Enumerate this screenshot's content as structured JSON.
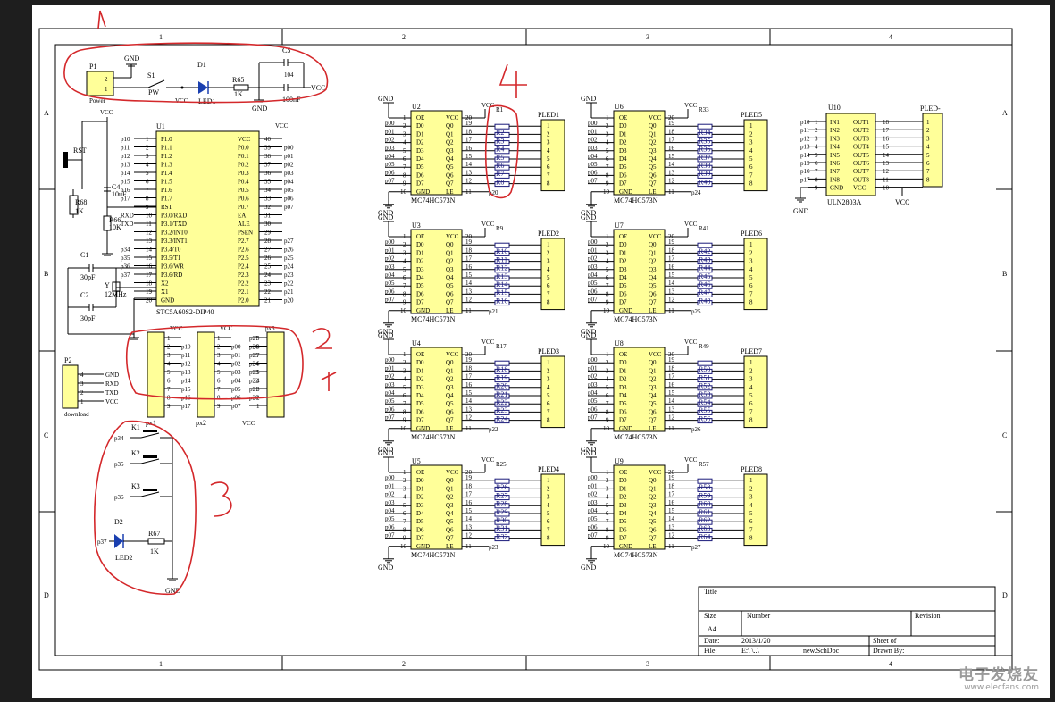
{
  "zones": {
    "cols": [
      "1",
      "2",
      "3",
      "4"
    ],
    "rows": [
      "A",
      "B",
      "C",
      "D"
    ]
  },
  "annotations": [
    "1",
    "2",
    "3",
    "4"
  ],
  "power": {
    "connector_ref": "P1",
    "connector_name": "Power",
    "pins": [
      "2",
      "1"
    ],
    "switch_ref": "S1",
    "switch_name": "PW",
    "led_ref": "D1",
    "led_name": "LED1",
    "res_ref": "R65",
    "res_val": "1K",
    "cap_ref": "C5",
    "cap_val": "100nF",
    "ecap": "104",
    "gnd": "GND",
    "vcc": "VCC"
  },
  "mcu": {
    "ref": "U1",
    "name": "STC5A60S2-DIP40",
    "left_pins": [
      {
        "num": "1",
        "name": "P1.0",
        "net": "p10"
      },
      {
        "num": "2",
        "name": "P1.1",
        "net": "p11"
      },
      {
        "num": "3",
        "name": "P1.2",
        "net": "p12"
      },
      {
        "num": "4",
        "name": "P1.3",
        "net": "p13"
      },
      {
        "num": "5",
        "name": "P1.4",
        "net": "p14"
      },
      {
        "num": "6",
        "name": "P1.5",
        "net": "p15"
      },
      {
        "num": "7",
        "name": "P1.6",
        "net": "p16"
      },
      {
        "num": "8",
        "name": "P1.7",
        "net": "p17"
      },
      {
        "num": "9",
        "name": "RST",
        "net": ""
      },
      {
        "num": "10",
        "name": "P3.0/RXD",
        "net": "RXD"
      },
      {
        "num": "11",
        "name": "P3.1/TXD",
        "net": "TXD"
      },
      {
        "num": "12",
        "name": "P3.2/INT0",
        "net": ""
      },
      {
        "num": "13",
        "name": "P3.3/INT1",
        "net": ""
      },
      {
        "num": "14",
        "name": "P3.4/T0",
        "net": "p34"
      },
      {
        "num": "15",
        "name": "P3.5/T1",
        "net": "p35"
      },
      {
        "num": "16",
        "name": "P3.6/WR",
        "net": "p36"
      },
      {
        "num": "17",
        "name": "P3.6/RD",
        "net": "p37"
      },
      {
        "num": "18",
        "name": "X2",
        "net": ""
      },
      {
        "num": "19",
        "name": "X1",
        "net": ""
      },
      {
        "num": "20",
        "name": "GND",
        "net": ""
      }
    ],
    "right_pins": [
      {
        "num": "40",
        "name": "VCC",
        "net": ""
      },
      {
        "num": "39",
        "name": "P0.0",
        "net": "p00"
      },
      {
        "num": "38",
        "name": "P0.1",
        "net": "p01"
      },
      {
        "num": "37",
        "name": "P0.2",
        "net": "p02"
      },
      {
        "num": "36",
        "name": "P0.3",
        "net": "p03"
      },
      {
        "num": "35",
        "name": "P0.4",
        "net": "p04"
      },
      {
        "num": "34",
        "name": "P0.5",
        "net": "p05"
      },
      {
        "num": "33",
        "name": "P0.6",
        "net": "p06"
      },
      {
        "num": "32",
        "name": "P0.7",
        "net": "p07"
      },
      {
        "num": "31",
        "name": "EA",
        "net": ""
      },
      {
        "num": "30",
        "name": "ALE",
        "net": ""
      },
      {
        "num": "29",
        "name": "PSEN",
        "net": ""
      },
      {
        "num": "28",
        "name": "P2.7",
        "net": "p27"
      },
      {
        "num": "27",
        "name": "P2.6",
        "net": "p26"
      },
      {
        "num": "26",
        "name": "P2.5",
        "net": "p25"
      },
      {
        "num": "25",
        "name": "P2.4",
        "net": "p24"
      },
      {
        "num": "24",
        "name": "P2.3",
        "net": "p23"
      },
      {
        "num": "23",
        "name": "P2.2",
        "net": "p22"
      },
      {
        "num": "22",
        "name": "P2.1",
        "net": "p21"
      },
      {
        "num": "21",
        "name": "P2.0",
        "net": "p20"
      }
    ],
    "vcc": "VCC"
  },
  "reset": {
    "button": "RST",
    "res_ref": "R68",
    "res_val": "1K",
    "cap_ref": "C4",
    "cap_val": "10uF",
    "pd_ref": "R66",
    "pd_val": "10K",
    "vcc": "VCC"
  },
  "crystal": {
    "c1_ref": "C1",
    "c1_val": "30pF",
    "c2_ref": "C2",
    "c2_val": "30pF",
    "y_ref": "Y",
    "y_val": "12MHz"
  },
  "download": {
    "ref": "P2",
    "name": "download",
    "pins": [
      "4",
      "3",
      "2",
      "1"
    ],
    "nets": [
      "GND",
      "RXD",
      "TXD",
      "VCC"
    ]
  },
  "headers": [
    {
      "ref": "px1",
      "vcc": "VCC",
      "nums": [
        "1",
        "2",
        "3",
        "4",
        "5",
        "6",
        "7",
        "8",
        "9"
      ],
      "nets": [
        "",
        "p10",
        "p11",
        "p12",
        "p13",
        "p14",
        "p15",
        "p16",
        "p17"
      ]
    },
    {
      "ref": "px2",
      "vcc": "VCC",
      "nums": [
        "1",
        "2",
        "3",
        "4",
        "5",
        "6",
        "7",
        "8",
        "9"
      ],
      "nets": [
        "",
        "p00",
        "p01",
        "p02",
        "p03",
        "p04",
        "p05",
        "p06",
        "p07"
      ]
    },
    {
      "ref": "px3",
      "vcc": "VCC",
      "nums": [
        "9",
        "8",
        "7",
        "6",
        "5",
        "4",
        "3",
        "2",
        "1"
      ],
      "nets": [
        "p27",
        "p26",
        "p25",
        "p24",
        "p23",
        "p22",
        "p21",
        "p20",
        ""
      ]
    }
  ],
  "keys": {
    "k1": "K1",
    "k2": "K2",
    "k3": "K3",
    "p34": "p34",
    "p35": "p35",
    "p36": "p36",
    "p37": "p37",
    "led_ref": "D2",
    "led_name": "LED2",
    "res_ref": "R67",
    "res_val": "1K",
    "gnd": "GND"
  },
  "latch": {
    "in_pins": [
      "2",
      "3",
      "4",
      "5",
      "6",
      "7",
      "8",
      "9"
    ],
    "out_pins": [
      "19",
      "18",
      "17",
      "16",
      "15",
      "14",
      "13",
      "12"
    ],
    "left_names": [
      "OE",
      "D0",
      "D1",
      "D2",
      "D3",
      "D4",
      "D5",
      "D6",
      "D7",
      "GND"
    ],
    "right_names": [
      "VCC",
      "Q0",
      "Q1",
      "Q2",
      "Q3",
      "Q4",
      "Q5",
      "Q6",
      "Q7",
      "LE"
    ],
    "top_left_num": "1",
    "top_right_num": "20",
    "bot_left_num": "10",
    "bot_right_num": "11",
    "in_nets": [
      "p00",
      "p01",
      "p02",
      "p03",
      "p04",
      "p05",
      "p06",
      "p07"
    ],
    "led_pins": [
      "1",
      "2",
      "3",
      "4",
      "5",
      "6",
      "7",
      "8"
    ],
    "vcc": "VCC",
    "gnd": "GND"
  },
  "blocks": [
    {
      "u": "U2",
      "part": "MC74HC573N",
      "le": "p20",
      "first_r": "R1",
      "resistors": [
        "R2",
        "R3",
        "R4",
        "R5",
        "R6",
        "R7",
        "R8"
      ],
      "led": "PLED1"
    },
    {
      "u": "U3",
      "part": "MC74HC573N",
      "le": "p21",
      "first_r": "R9",
      "resistors": [
        "R10",
        "R11",
        "R12",
        "R13",
        "R14",
        "R15",
        "R16"
      ],
      "led": "PLED2"
    },
    {
      "u": "U4",
      "part": "MC74HC573N",
      "le": "p22",
      "first_r": "R17",
      "resistors": [
        "R18",
        "R19",
        "R20",
        "R21",
        "R22",
        "R23",
        "R24"
      ],
      "led": "PLED3"
    },
    {
      "u": "U5",
      "part": "MC74HC573N",
      "le": "p23",
      "first_r": "R25",
      "resistors": [
        "R26",
        "R27",
        "R28",
        "R29",
        "R30",
        "R31",
        "R32"
      ],
      "led": "PLED4"
    },
    {
      "u": "U6",
      "part": "MC74HC573N",
      "le": "p24",
      "first_r": "R33",
      "resistors": [
        "R34",
        "R35",
        "R36",
        "R37",
        "R38",
        "R39",
        "R40"
      ],
      "led": "PLED5"
    },
    {
      "u": "U7",
      "part": "MC74HC573N",
      "le": "p25",
      "first_r": "R41",
      "resistors": [
        "R42",
        "R43",
        "R44",
        "R45",
        "R46",
        "R47",
        "R48"
      ],
      "led": "PLED6"
    },
    {
      "u": "U8",
      "part": "MC74HC573N",
      "le": "p26",
      "first_r": "R49",
      "resistors": [
        "R50",
        "R51",
        "R52",
        "R53",
        "R54",
        "R55",
        "R56"
      ],
      "led": "PLED7"
    },
    {
      "u": "U9",
      "part": "MC74HC573N",
      "le": "p27",
      "first_r": "R57",
      "resistors": [
        "R58",
        "R59",
        "R60",
        "R61",
        "R62",
        "R63",
        "R64"
      ],
      "led": "PLED8"
    }
  ],
  "uln": {
    "ref": "U10",
    "name": "ULN2803A",
    "in_names": [
      "IN1",
      "IN2",
      "IN3",
      "IN4",
      "IN5",
      "IN6",
      "IN7",
      "IN8",
      "GND"
    ],
    "out_names": [
      "OUT1",
      "OUT2",
      "OUT3",
      "OUT4",
      "OUT5",
      "OUT6",
      "OUT7",
      "OUT8",
      "VCC"
    ],
    "in_nums": [
      "1",
      "2",
      "3",
      "4",
      "5",
      "6",
      "7",
      "8",
      "9"
    ],
    "out_nums": [
      "18",
      "17",
      "16",
      "15",
      "14",
      "13",
      "12",
      "11",
      "10"
    ],
    "in_nets": [
      "p10",
      "p11",
      "p12",
      "p13",
      "p14",
      "p15",
      "p16",
      "p17"
    ],
    "led": "PLED-",
    "led_pins": [
      "1",
      "2",
      "3",
      "4",
      "5",
      "6",
      "7",
      "8"
    ],
    "gnd": "GND",
    "vcc": "VCC"
  },
  "title_block": {
    "title_label": "Title",
    "size_label": "Size",
    "size_value": "A4",
    "number_label": "Number",
    "revision_label": "Revision",
    "date_label": "Date:",
    "date_value": "2013/1/20",
    "sheet_label": "Sheet    of",
    "file_label": "File:",
    "file_value": "E:\\          \\..\\",
    "file_name": "new.SchDoc",
    "drawn_label": "Drawn By:"
  },
  "watermark": {
    "title": "电子发烧友",
    "url": "www.elecfans.com"
  },
  "colors": {
    "ink": "#000000",
    "part_fill": "#ffff99",
    "annotation": "#d4282b",
    "wire": "#1a1a7a",
    "background": "#1e1e1e"
  }
}
